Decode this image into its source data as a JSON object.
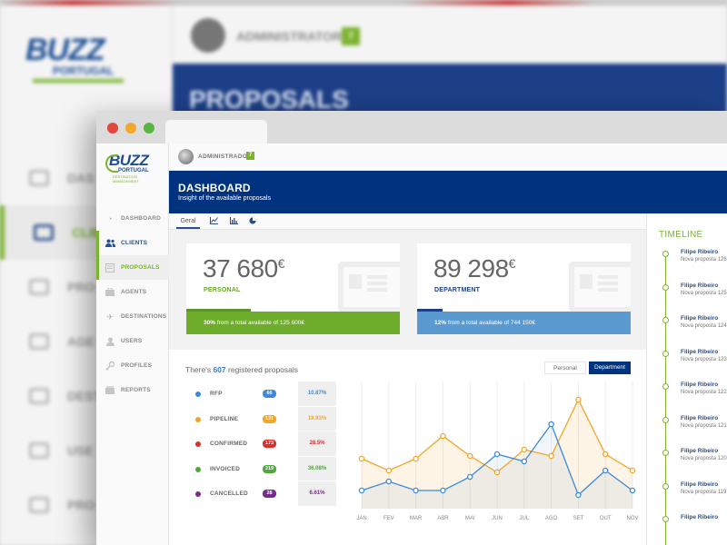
{
  "background": {
    "admin_name": "ADMINISTRATOR",
    "admin_badge": "7",
    "banner_title": "PROPOSALS",
    "logo_main": "BUZZ",
    "logo_sub": "PORTUGAL",
    "logo_tagline": "DESTINATION MANAGEMENT"
  },
  "logo": {
    "main": "BUZZ",
    "sub": "PORTUGAL",
    "tagline": "DESTINATION MANAGEMENT"
  },
  "header": {
    "admin_name": "ADMINISTRADOR",
    "admin_badge": "7"
  },
  "banner": {
    "title": "DASHBOARD",
    "subtitle": "Insight of the available proposals"
  },
  "tabs": [
    {
      "label": "Geral",
      "icon": ""
    },
    {
      "label": "",
      "icon": "line-chart-icon"
    },
    {
      "label": "",
      "icon": "bar-chart-icon"
    },
    {
      "label": "",
      "icon": "pie-chart-icon"
    }
  ],
  "sidebar": {
    "items": [
      {
        "label": "DASHBOARD",
        "icon": "dashboard-icon"
      },
      {
        "label": "CLIENTS",
        "icon": "users-icon"
      },
      {
        "label": "PROPOSALS",
        "icon": "document-icon"
      },
      {
        "label": "AGENTS",
        "icon": "briefcase-icon"
      },
      {
        "label": "DESTINATIONS",
        "icon": "plane-icon"
      },
      {
        "label": "USERS",
        "icon": "user-icon"
      },
      {
        "label": "PROFILES",
        "icon": "key-icon"
      },
      {
        "label": "REPORTS",
        "icon": "report-icon"
      }
    ]
  },
  "cards": {
    "personal": {
      "amount": "37 680",
      "currency": "€",
      "label": "PERSONAL",
      "percent": "30%",
      "footer": "from a total available of 125 600€",
      "fill": 0.3,
      "color": "#6eac2b"
    },
    "department": {
      "amount": "89 298",
      "currency": "€",
      "label": "DEPARTMENT",
      "percent": "12%",
      "footer": "from a total available of 744 150€",
      "fill": 0.12,
      "color": "#5a9ad0"
    }
  },
  "proposals": {
    "title_prefix": "There's",
    "count": "607",
    "title_suffix": "registered proposals",
    "toggle_personal": "Personal",
    "toggle_department": "Department",
    "statuses": [
      {
        "name": "RFP",
        "count": "66",
        "percent": "10.87%",
        "color": "#3c8ad8"
      },
      {
        "name": "PIPELINE",
        "count": "121",
        "percent": "19.93%",
        "color": "#f2a52c"
      },
      {
        "name": "CONFIRMED",
        "count": "173",
        "percent": "28.5%",
        "color": "#d8302c"
      },
      {
        "name": "INVOICED",
        "count": "219",
        "percent": "36.08%",
        "color": "#4fa83a"
      },
      {
        "name": "CANCELLED",
        "count": "28",
        "percent": "6.61%",
        "color": "#7a2a8c"
      }
    ]
  },
  "chart_data": {
    "type": "line",
    "x": [
      "JAN",
      "FEV",
      "MAR",
      "ABR",
      "MAI",
      "JUN",
      "JUL",
      "AGO",
      "SET",
      "OUT",
      "NOV"
    ],
    "grid": true,
    "legend": "none",
    "series": [
      {
        "values": [
          55,
          42,
          55,
          80,
          58,
          40,
          65,
          58,
          120,
          60,
          42
        ],
        "color": "#f2a52c"
      },
      {
        "values": [
          20,
          30,
          20,
          20,
          35,
          60,
          52,
          93,
          15,
          42,
          20
        ],
        "color": "#3c8ad8"
      }
    ],
    "ylim": [
      0,
      140
    ]
  },
  "timeline": {
    "title": "TIMELINE",
    "items": [
      {
        "name": "Filipe Ribeiro",
        "desc": "Nova proposta 126"
      },
      {
        "name": "Filipe Ribeiro",
        "desc": "Nova proposta 125"
      },
      {
        "name": "Filipe Ribeiro",
        "desc": "Nova proposta 124"
      },
      {
        "name": "Filipe Ribeiro",
        "desc": "Nova proposta 123"
      },
      {
        "name": "Filipe Ribeiro",
        "desc": "Nova proposta 122"
      },
      {
        "name": "Filipe Ribeiro",
        "desc": "Nova proposta 121"
      },
      {
        "name": "Filipe Ribeiro",
        "desc": "Nova proposta 120"
      },
      {
        "name": "Filipe Ribeiro",
        "desc": "Nova proposta 119"
      },
      {
        "name": "Filipe Ribeiro",
        "desc": ""
      }
    ]
  }
}
